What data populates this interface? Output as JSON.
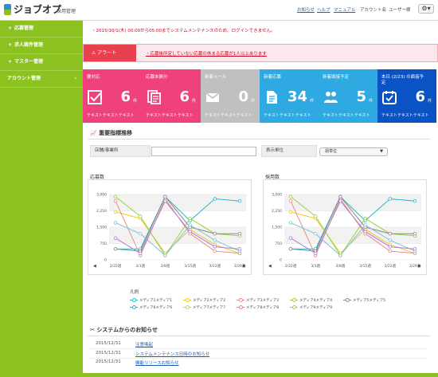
{
  "header": {
    "brand": "ジョブオプ",
    "subtitle": "採用管理",
    "nav": {
      "notice": "お知らせ",
      "help": "ヘルプ",
      "manual": "マニュアル",
      "account": "アカウント名",
      "user": "ユーザー様"
    },
    "gear_icon": "gear-icon"
  },
  "sidebar": {
    "items": [
      {
        "label": "応募管理"
      },
      {
        "label": "求人案件管理"
      },
      {
        "label": "マスター管理"
      },
      {
        "label": "アカウント管理"
      }
    ]
  },
  "notice": "・2015/10/1(木) 00:00から05:00までシステムメンテナンスのため、ログインできません。",
  "alert": {
    "label": "アラート",
    "message": "・応募後所定していない応募の休まる応募が1人以上あります"
  },
  "tiles": [
    {
      "label": "要対応",
      "label2": "",
      "value": "6",
      "unit": "件",
      "foot": "テキストテキストテキスト",
      "color": "#f0427a",
      "icon": "check-icon"
    },
    {
      "label": "応募未振分",
      "label2": "",
      "value": "6",
      "unit": "件",
      "foot": "テキストテキストテキスト",
      "color": "#f0427a",
      "icon": "document-icon"
    },
    {
      "label": "新着メール",
      "label2": "",
      "value": "0",
      "unit": "件",
      "foot": "テキストテキストテキスト",
      "color": "#c0c0c0",
      "icon": "mail-icon"
    },
    {
      "label": "新着応募",
      "label2": "",
      "value": "34",
      "unit": "件",
      "foot": "テキストテキストテキスト",
      "color": "#2ea9e1",
      "icon": "file-icon"
    },
    {
      "label": "新着面接予定",
      "label2": "",
      "value": "5",
      "unit": "件",
      "foot": "テキストテキストテキスト",
      "color": "#2ea9e1",
      "icon": "people-icon"
    },
    {
      "label": "本日 (2/23) の面接予",
      "label2": "定",
      "value": "6",
      "unit": "件",
      "foot": "テキストテキストテキスト",
      "color": "#0b53c4",
      "icon": "calendar-icon"
    }
  ],
  "kpi": {
    "title": "重要指標推移",
    "store_label": "店舗/事業所",
    "store_value": "",
    "unit_label": "表示単位",
    "unit_value": "週単位"
  },
  "legend": {
    "title": "凡例",
    "items": [
      "メディア1メディア1",
      "メディア2メディア2",
      "メディア3メディア3",
      "メディア4メディア4",
      "メディア5メディア5",
      "メディア6メディア6",
      "メディア7メディア7",
      "メディア8メディア8",
      "メディア9メディア9"
    ]
  },
  "news": {
    "title": "システムからのお知らせ",
    "items": [
      {
        "date": "2015/12/31",
        "title": "注意喚起"
      },
      {
        "date": "2015/12/31",
        "title": "システムメンテナンス日時のお知らせ"
      },
      {
        "date": "2015/12/31",
        "title": "機能リリースお知らせ"
      }
    ]
  },
  "chart_data": [
    {
      "type": "line",
      "title": "応募数",
      "categories": [
        "2/22週",
        "3/1週",
        "3/8週",
        "3/15週",
        "3/22週",
        "3/29週"
      ],
      "ylim": [
        0,
        3000
      ],
      "yticks": [
        "3,000",
        "2,250",
        "1,500",
        "750",
        "0"
      ],
      "grid": true,
      "series": [
        {
          "color": "#2bb5c9",
          "values": [
            500,
            500,
            2900,
            1800,
            2800,
            2700
          ]
        },
        {
          "color": "#f2c81e",
          "values": [
            2200,
            1900,
            300,
            1400,
            700,
            300
          ]
        },
        {
          "color": "#e88a8a",
          "values": [
            2700,
            200,
            2800,
            1200,
            400,
            300
          ]
        },
        {
          "color": "#9bd13f",
          "values": [
            2900,
            2000,
            200,
            1900,
            1200,
            1100
          ]
        },
        {
          "color": "#8a8a8a",
          "values": [
            500,
            400,
            2900,
            1500,
            1200,
            1200
          ]
        },
        {
          "color": "#7ac4d8",
          "values": [
            1700,
            1200,
            200,
            1600,
            900,
            400
          ]
        },
        {
          "color": "#b07bd0",
          "values": [
            1000,
            300,
            2700,
            1300,
            600,
            500
          ]
        }
      ]
    },
    {
      "type": "line",
      "title": "採用数",
      "categories": [
        "2/22週",
        "3/1週",
        "3/8週",
        "3/15週",
        "3/22週",
        "3/29週"
      ],
      "ylim": [
        0,
        3000
      ],
      "yticks": [
        "3,000",
        "2,250",
        "1,500",
        "750",
        "0"
      ],
      "grid": true,
      "series": [
        {
          "color": "#2bb5c9",
          "values": [
            500,
            500,
            2900,
            1800,
            2800,
            2700
          ]
        },
        {
          "color": "#f2c81e",
          "values": [
            2200,
            1900,
            300,
            1400,
            700,
            300
          ]
        },
        {
          "color": "#e88a8a",
          "values": [
            2700,
            200,
            2800,
            1200,
            400,
            300
          ]
        },
        {
          "color": "#9bd13f",
          "values": [
            2900,
            2000,
            200,
            1900,
            1200,
            1100
          ]
        },
        {
          "color": "#8a8a8a",
          "values": [
            500,
            400,
            2900,
            1500,
            1200,
            1200
          ]
        },
        {
          "color": "#7ac4d8",
          "values": [
            1700,
            1200,
            200,
            1600,
            900,
            400
          ]
        },
        {
          "color": "#b07bd0",
          "values": [
            1000,
            300,
            2700,
            1300,
            600,
            500
          ]
        }
      ]
    }
  ],
  "legend_colors": [
    "#2bb5c9",
    "#f2c81e",
    "#e88a8a",
    "#9bd13f",
    "#8a8a8a",
    "#2bb5c9",
    "#f2c81e",
    "#e88a8a",
    "#9bd13f"
  ]
}
